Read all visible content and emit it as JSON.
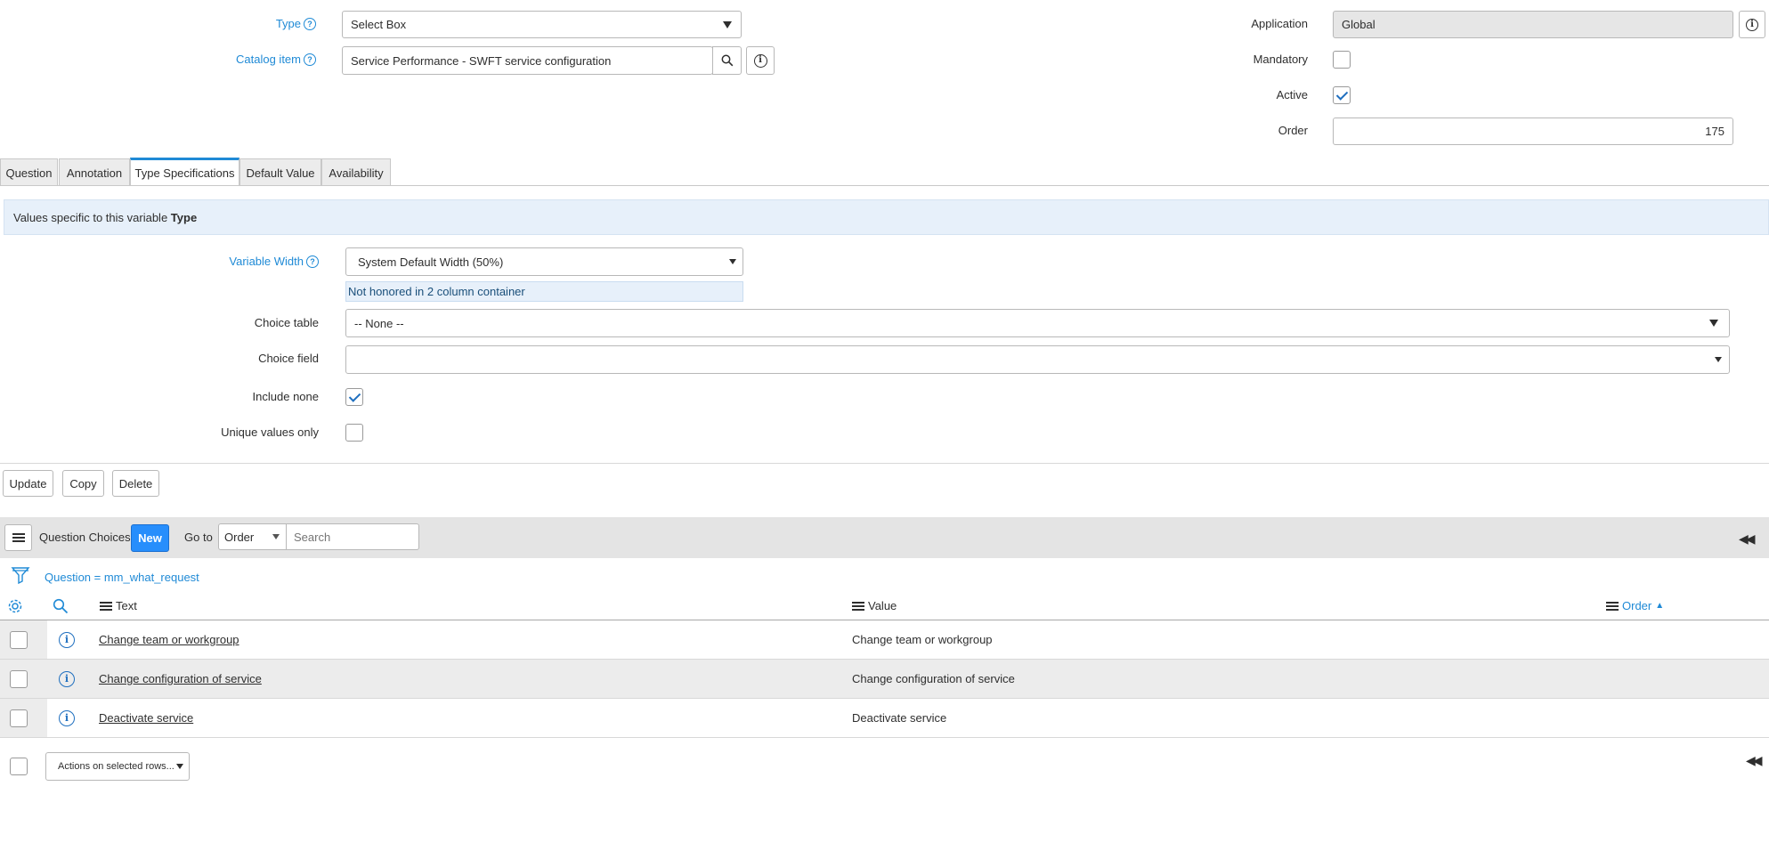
{
  "form": {
    "type_label": "Type",
    "type_value": "Select Box",
    "catalog_item_label": "Catalog item",
    "catalog_item_value": "Service Performance - SWFT service configuration",
    "application_label": "Application",
    "application_value": "Global",
    "mandatory_label": "Mandatory",
    "mandatory_checked": false,
    "active_label": "Active",
    "active_checked": true,
    "order_label": "Order",
    "order_value": "175"
  },
  "tabs": [
    {
      "label": "Question",
      "active": false
    },
    {
      "label": "Annotation",
      "active": false
    },
    {
      "label": "Type Specifications",
      "active": true
    },
    {
      "label": "Default Value",
      "active": false
    },
    {
      "label": "Availability",
      "active": false
    }
  ],
  "type_spec": {
    "banner_prefix": "Values specific to this variable ",
    "banner_bold": "Type",
    "variable_width_label": "Variable Width",
    "variable_width_value": "System Default Width (50%)",
    "width_note": "Not honored in 2 column container",
    "choice_table_label": "Choice table",
    "choice_table_value": "-- None --",
    "choice_field_label": "Choice field",
    "choice_field_value": "",
    "include_none_label": "Include none",
    "include_none_checked": true,
    "unique_values_label": "Unique values only",
    "unique_values_checked": false
  },
  "actions": {
    "update": "Update",
    "copy": "Copy",
    "delete": "Delete"
  },
  "related_list": {
    "title": "Question Choices",
    "new_label": "New",
    "goto_label": "Go to",
    "goto_field": "Order",
    "search_placeholder": "Search",
    "filter_text": "Question = mm_what_request",
    "columns": {
      "text": "Text",
      "value": "Value",
      "order": "Order"
    },
    "rows": [
      {
        "text": "Change team or workgroup",
        "value": "Change team or workgroup"
      },
      {
        "text": "Change configuration of service",
        "value": "Change configuration of service"
      },
      {
        "text": "Deactivate service",
        "value": "Deactivate service"
      }
    ],
    "bulk_actions": "Actions on selected rows..."
  },
  "colors": {
    "accent": "#1f8ad6",
    "new_button": "#278efc",
    "banner_bg": "#e7f0fa",
    "list_header_bg": "#e4e4e4",
    "alt_row_bg": "#ececec"
  }
}
